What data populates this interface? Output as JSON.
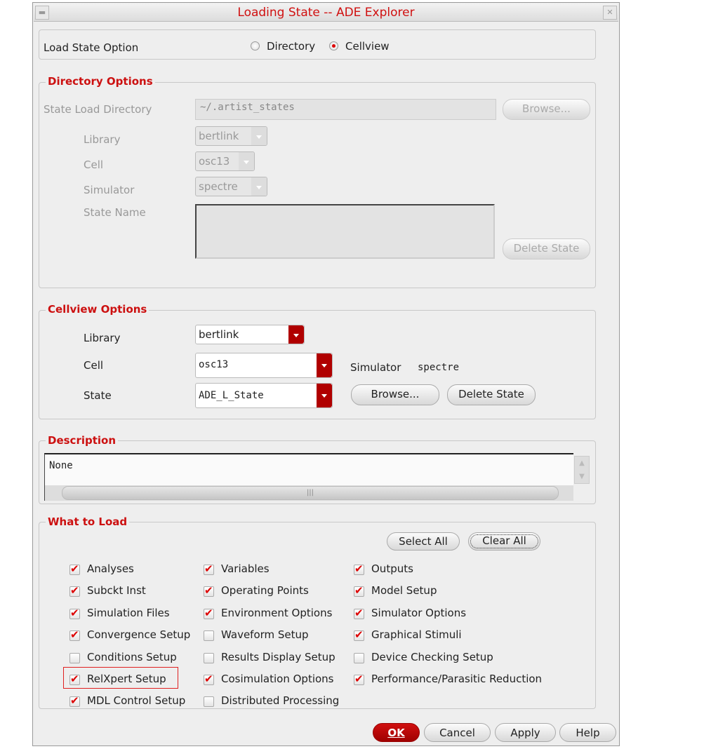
{
  "window": {
    "title": "Loading State -- ADE Explorer"
  },
  "load_state": {
    "label": "Load State Option",
    "options": [
      "Directory",
      "Cellview"
    ],
    "selected": "Cellview"
  },
  "directory_options": {
    "title": "Directory Options",
    "dir_label": "State Load Directory",
    "dir_value": "~/.artist_states",
    "browse": "Browse...",
    "library_label": "Library",
    "library_value": "bertlink",
    "cell_label": "Cell",
    "cell_value": "osc13",
    "simulator_label": "Simulator",
    "simulator_value": "spectre",
    "state_name_label": "State Name",
    "delete_state": "Delete State"
  },
  "cellview_options": {
    "title": "Cellview Options",
    "library_label": "Library",
    "library_value": "bertlink",
    "cell_label": "Cell",
    "cell_value": "osc13",
    "state_label": "State",
    "state_value": "ADE_L_State",
    "simulator_label": "Simulator",
    "simulator_value": "spectre",
    "browse": "Browse...",
    "delete_state": "Delete State"
  },
  "description": {
    "title": "Description",
    "value": "None"
  },
  "what_to_load": {
    "title": "What to Load",
    "select_all": "Select All",
    "clear_all": "Clear All",
    "items": [
      {
        "label": "Analyses",
        "checked": true
      },
      {
        "label": "Variables",
        "checked": true
      },
      {
        "label": "Outputs",
        "checked": true
      },
      {
        "label": "Subckt Inst",
        "checked": true
      },
      {
        "label": "Operating Points",
        "checked": true
      },
      {
        "label": "Model Setup",
        "checked": true
      },
      {
        "label": "Simulation Files",
        "checked": true
      },
      {
        "label": "Environment Options",
        "checked": true
      },
      {
        "label": "Simulator Options",
        "checked": true
      },
      {
        "label": "Convergence Setup",
        "checked": true
      },
      {
        "label": "Waveform Setup",
        "checked": false
      },
      {
        "label": "Graphical Stimuli",
        "checked": true
      },
      {
        "label": "Conditions Setup",
        "checked": false
      },
      {
        "label": "Results Display Setup",
        "checked": false
      },
      {
        "label": "Device Checking Setup",
        "checked": false
      },
      {
        "label": "RelXpert Setup",
        "checked": true,
        "highlighted": true
      },
      {
        "label": "Cosimulation Options",
        "checked": true
      },
      {
        "label": "Performance/Parasitic Reduction",
        "checked": true
      },
      {
        "label": "MDL Control Setup",
        "checked": true
      },
      {
        "label": "Distributed Processing",
        "checked": false
      }
    ]
  },
  "footer": {
    "ok": "OK",
    "cancel": "Cancel",
    "apply": "Apply",
    "help": "Help"
  },
  "colors": {
    "accent": "#cc1010",
    "highlight_box": "#e02020"
  }
}
